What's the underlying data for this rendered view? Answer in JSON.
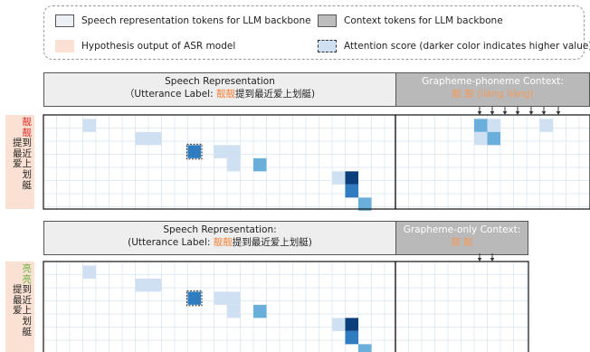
{
  "legend": {
    "speech_tokens": "Speech representation tokens for LLM backbone",
    "context_tokens": "Context tokens for LLM backbone",
    "hypothesis": "Hypothesis output of ASR model",
    "attention": "Attention score (darker color indicates higher value)"
  },
  "panel_top": {
    "speech_title": "Speech Representation",
    "label_prefix": "（Utterance Label: ",
    "label_highlight": "靓靓",
    "label_rest": "提到最近爱上划艇)",
    "context_title": "Grapheme-phoneme Context:",
    "context_chars": "靓 靓 (liàng liàng)",
    "row_labels": [
      "靓",
      "靓",
      "提到",
      "最近",
      "爱上",
      "划",
      "艇"
    ],
    "row_label_colors": [
      "#e0312d",
      "#e0312d",
      "#222222",
      "#222222",
      "#222222",
      "#222222",
      "#222222"
    ]
  },
  "panel_bottom": {
    "speech_title": "Speech Representation:",
    "label_prefix": "(Utterance Label: ",
    "label_highlight": "靓靓",
    "label_rest": "提到最近爱上划艇)",
    "context_title": "Grapheme-only Context:",
    "context_chars": "靓 靓",
    "row_labels": [
      "亮",
      "亮",
      "提到",
      "最近",
      "爱上",
      "划",
      "艇"
    ],
    "row_label_colors": [
      "#6ab33f",
      "#6ab33f",
      "#222222",
      "#222222",
      "#222222",
      "#222222",
      "#222222"
    ]
  },
  "colors": {
    "grid_line": "#d6e4f0",
    "light": "#cfe0f2",
    "mid": "#6aaedb",
    "strong": "#2f7cc0",
    "darkest": "#0b3f7c"
  }
}
